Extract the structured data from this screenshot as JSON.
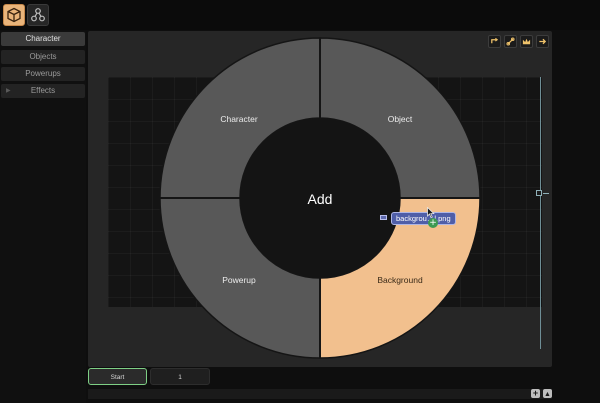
{
  "toolbar": {
    "tools": [
      {
        "icon": "cube-icon",
        "active": true
      },
      {
        "icon": "nodes-icon",
        "active": false
      }
    ]
  },
  "sidebar": {
    "items": [
      {
        "label": "Character",
        "selected": true,
        "expandable": false
      },
      {
        "label": "Objects",
        "selected": false,
        "expandable": false
      },
      {
        "label": "Powerups",
        "selected": false,
        "expandable": false
      },
      {
        "label": "Effects",
        "selected": false,
        "expandable": true
      }
    ]
  },
  "canvas": {
    "corner_buttons": [
      "rotate-icon",
      "link-icon",
      "crown-icon",
      "arrow-right-icon"
    ]
  },
  "radial_menu": {
    "center_label": "Add",
    "options": [
      {
        "label": "Character",
        "highlighted": false
      },
      {
        "label": "Object",
        "highlighted": false
      },
      {
        "label": "Powerup",
        "highlighted": false
      },
      {
        "label": "Background",
        "highlighted": true
      }
    ],
    "colors": {
      "segment": "#585858",
      "highlight": "#f2c08e",
      "divider": "#151515",
      "center": "#141414"
    }
  },
  "drag_item": {
    "filename": "backgrou…l.png"
  },
  "timeline": {
    "frames": [
      "Start",
      "1"
    ]
  },
  "footer": {
    "buttons": [
      "+",
      "▲"
    ]
  }
}
